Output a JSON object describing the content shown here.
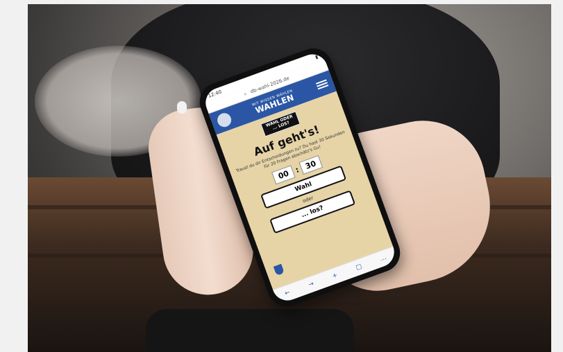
{
  "phone": {
    "status_time": "12:40",
    "url": "db-wahl-2026.de",
    "header": {
      "brand_small": "MIT WISSEN WÄHLEN",
      "brand_big": "WAHLEN"
    },
    "badge": {
      "line1": "WAHL ODER",
      "line2": "... LOS?"
    },
    "title": "Auf geht's!",
    "intro": "Traust du dir Entscheidungen zu? Du hast 30 Sekunden für 20 Fragen abschätz's Gu!",
    "timer": {
      "minutes": "00",
      "seconds": "30"
    },
    "buttons": {
      "wahl": "Wahl",
      "oder": "oder",
      "los": "... los?"
    },
    "bottom_icons": [
      "←",
      "→",
      "+",
      "□",
      "…"
    ]
  }
}
